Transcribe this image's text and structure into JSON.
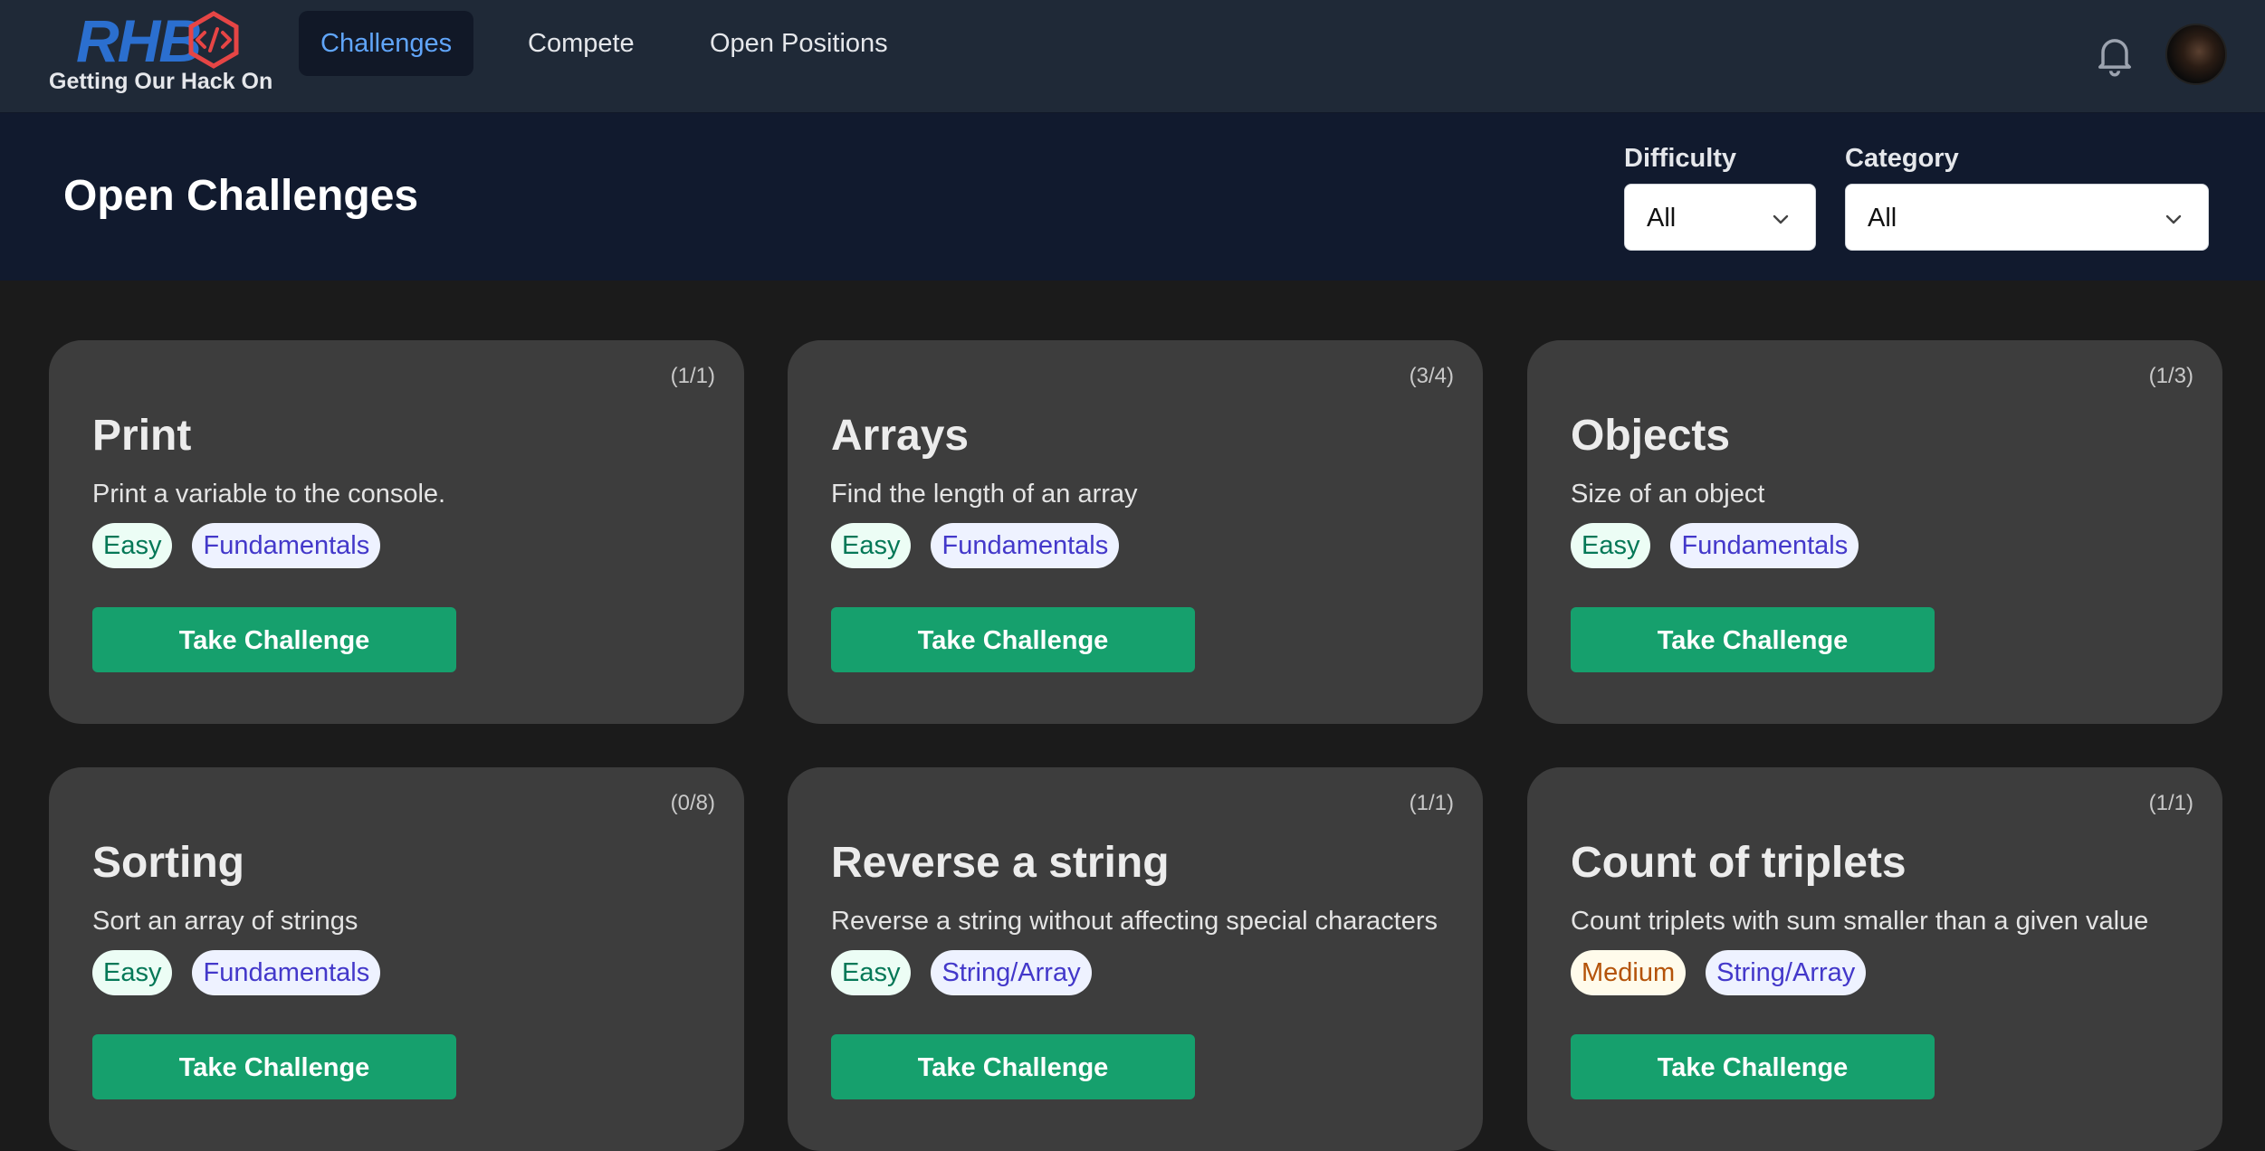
{
  "brand": {
    "logo_text": "RHB",
    "tagline": "Getting Our Hack On"
  },
  "nav": {
    "tabs": [
      {
        "label": "Challenges",
        "active": true
      },
      {
        "label": "Compete",
        "active": false
      },
      {
        "label": "Open Positions",
        "active": false
      }
    ],
    "icons": {
      "notifications": "bell-icon",
      "profile": "avatar"
    }
  },
  "header": {
    "title": "Open Challenges",
    "filters": {
      "difficulty": {
        "label": "Difficulty",
        "value": "All"
      },
      "category": {
        "label": "Category",
        "value": "All"
      }
    }
  },
  "colors": {
    "accent_blue": "#60a5fa",
    "button_green": "#16a06d",
    "card_bg": "#3d3d3d",
    "header_bg": "#111a2e",
    "nav_bg": "#1f2937"
  },
  "cards": [
    {
      "count": "(1/1)",
      "title": "Print",
      "description": "Print a variable to the console.",
      "difficulty": "Easy",
      "category": "Fundamentals",
      "button": "Take Challenge"
    },
    {
      "count": "(3/4)",
      "title": "Arrays",
      "description": "Find the length of an array",
      "difficulty": "Easy",
      "category": "Fundamentals",
      "button": "Take Challenge"
    },
    {
      "count": "(1/3)",
      "title": "Objects",
      "description": "Size of an object",
      "difficulty": "Easy",
      "category": "Fundamentals",
      "button": "Take Challenge"
    },
    {
      "count": "(0/8)",
      "title": "Sorting",
      "description": "Sort an array of strings",
      "difficulty": "Easy",
      "category": "Fundamentals",
      "button": "Take Challenge"
    },
    {
      "count": "(1/1)",
      "title": "Reverse a string",
      "description": "Reverse a string without affecting special characters",
      "difficulty": "Easy",
      "category": "String/Array",
      "button": "Take Challenge"
    },
    {
      "count": "(1/1)",
      "title": "Count of triplets",
      "description": "Count triplets with sum smaller than a given value",
      "difficulty": "Medium",
      "category": "String/Array",
      "button": "Take Challenge"
    }
  ]
}
